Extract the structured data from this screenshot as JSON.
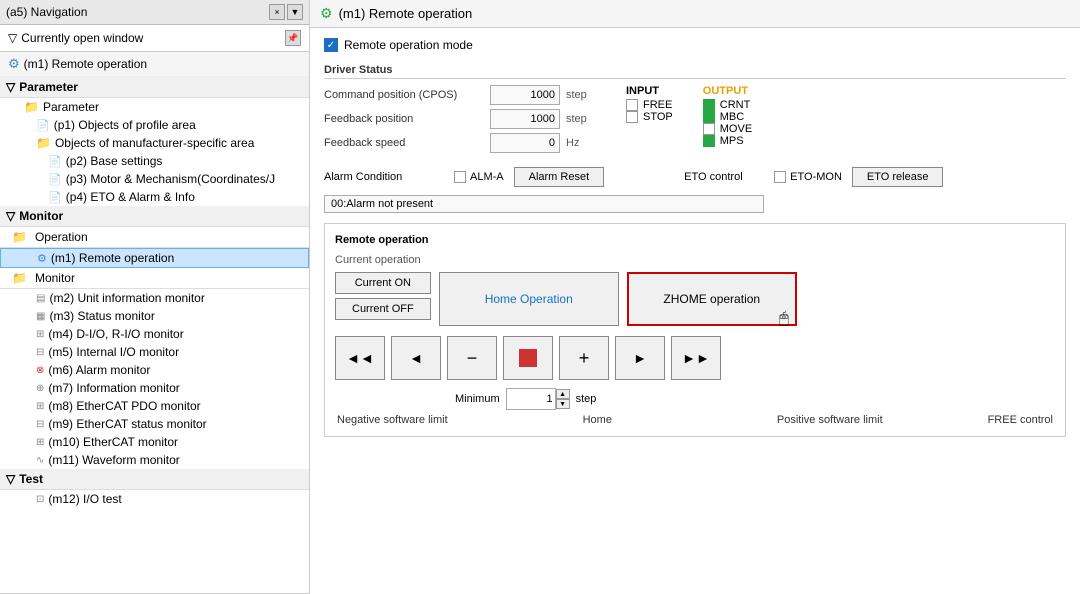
{
  "left": {
    "title_bar": {
      "text": "(a5) Navigation",
      "close_label": "×",
      "dropdown_label": "▼"
    },
    "current_window": {
      "label": "Currently open window",
      "pin_label": "📌"
    },
    "remote_nav_item": "(m1) Remote operation",
    "parameter_section": "Parameter",
    "tree_items": [
      {
        "label": "Parameter",
        "indent": 1,
        "icon": "folder"
      },
      {
        "label": "(p1) Objects of profile area",
        "indent": 2,
        "icon": "doc"
      },
      {
        "label": "Objects of manufacturer-specific area",
        "indent": 2,
        "icon": "folder"
      },
      {
        "label": "(p2) Base settings",
        "indent": 3,
        "icon": "doc"
      },
      {
        "label": "(p3) Motor & Mechanism(Coordinates/J",
        "indent": 3,
        "icon": "doc"
      },
      {
        "label": "(p4) ETO & Alarm & Info",
        "indent": 3,
        "icon": "doc"
      }
    ],
    "monitor_section": "Monitor",
    "operation_section": "Operation",
    "operation_items": [
      {
        "label": "(m1) Remote operation",
        "indent": 2,
        "selected": true,
        "icon": "gear"
      }
    ],
    "monitor_items": [
      {
        "label": "Monitor",
        "indent": 1,
        "icon": "folder"
      },
      {
        "label": "(m2) Unit information monitor",
        "indent": 2,
        "icon": "list"
      },
      {
        "label": "(m3) Status monitor",
        "indent": 2,
        "icon": "list2"
      },
      {
        "label": "(m4) D-I/O, R-I/O monitor",
        "indent": 2,
        "icon": "io"
      },
      {
        "label": "(m5) Internal I/O monitor",
        "indent": 2,
        "icon": "io2"
      },
      {
        "label": "(m6) Alarm monitor",
        "indent": 2,
        "icon": "alarm"
      },
      {
        "label": "(m7) Information monitor",
        "indent": 2,
        "icon": "info"
      },
      {
        "label": "(m8) EtherCAT PDO monitor",
        "indent": 2,
        "icon": "eth"
      },
      {
        "label": "(m9) EtherCAT status monitor",
        "indent": 2,
        "icon": "eth2"
      },
      {
        "label": "(m10) EtherCAT monitor",
        "indent": 2,
        "icon": "eth3"
      },
      {
        "label": "(m11) Waveform monitor",
        "indent": 2,
        "icon": "wave"
      }
    ],
    "test_section": "Test",
    "test_items": [
      {
        "label": "(m12) I/O test",
        "indent": 2,
        "icon": "test"
      }
    ]
  },
  "right": {
    "header_title": "(m1) Remote operation",
    "remote_mode_label": "Remote operation mode",
    "driver_status_label": "Driver Status",
    "fields": [
      {
        "label": "Command position (CPOS)",
        "value": "1000",
        "unit": "step"
      },
      {
        "label": "Feedback position",
        "value": "1000",
        "unit": "step"
      },
      {
        "label": "Feedback speed",
        "value": "0",
        "unit": "Hz"
      }
    ],
    "input_label": "INPUT",
    "output_label": "OUTPUT",
    "input_items": [
      {
        "label": "FREE",
        "checked": false
      },
      {
        "label": "STOP",
        "checked": false
      }
    ],
    "output_items": [
      {
        "label": "CRNT",
        "checked": true
      },
      {
        "label": "MBC",
        "checked": true
      },
      {
        "label": "MOVE",
        "checked": false
      },
      {
        "label": "MPS",
        "checked": true
      }
    ],
    "alarm_condition_label": "Alarm Condition",
    "alm_label": "ALM-A",
    "alarm_reset_label": "Alarm Reset",
    "eto_control_label": "ETO control",
    "eto_mon_label": "ETO-MON",
    "eto_release_label": "ETO release",
    "alarm_msg": "00:Alarm not present",
    "remote_op_label": "Remote operation",
    "current_op_label": "Current operation",
    "current_on_label": "Current ON",
    "current_off_label": "Current OFF",
    "home_op_label": "Home Operation",
    "zhome_op_label": "ZHOME operation",
    "jog_buttons": [
      "◄◄",
      "◄",
      "−",
      "■",
      "+",
      "►",
      "►►"
    ],
    "minimum_label": "Minimum",
    "minimum_value": "1",
    "step_label": "step",
    "jog_labels": [
      "Negative software limit",
      "Home",
      "Positive software limit",
      "FREE control"
    ]
  }
}
